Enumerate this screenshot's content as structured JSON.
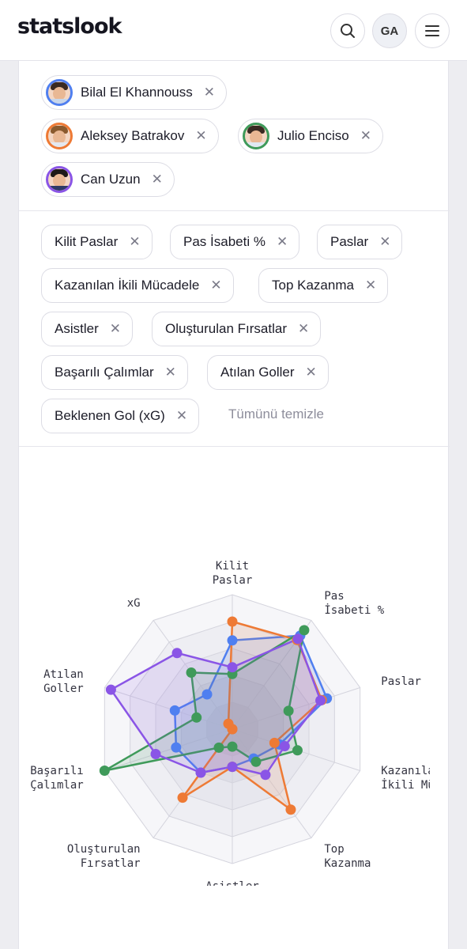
{
  "header": {
    "logo": "statslook",
    "avatar_initials": "GA"
  },
  "players": [
    {
      "name": "Bilal El Khannouss",
      "color": "#4f7ff0"
    },
    {
      "name": "Aleksey Batrakov",
      "color": "#ee7a35"
    },
    {
      "name": "Julio Enciso",
      "color": "#3f9a5a"
    },
    {
      "name": "Can Uzun",
      "color": "#8a55e6"
    }
  ],
  "metrics": [
    "Kilit Paslar",
    "Pas İsabeti %",
    "Paslar",
    "Kazanılan İkili Mücadele",
    "Top Kazanma",
    "Asistler",
    "Oluşturulan Fırsatlar",
    "Başarılı Çalımlar",
    "Atılan Goller",
    "Beklenen Gol (xG)"
  ],
  "clear_all": "Tümünü temizle",
  "chart_data": {
    "type": "radar",
    "axes": [
      [
        "Kilit",
        "Paslar"
      ],
      [
        "Pas",
        "İsabeti %"
      ],
      [
        "Paslar"
      ],
      [
        "Kazanıla",
        "İkili Mü"
      ],
      [
        "Top",
        "Kazanma"
      ],
      [
        "Asistler"
      ],
      [
        "Oluşturulan",
        "Fırsatlar"
      ],
      [
        "Başarılı",
        "Çalımlar"
      ],
      [
        "Atılan",
        "Goller"
      ],
      [
        "xG"
      ]
    ],
    "grid_levels": 5,
    "max": 1.0,
    "series": [
      {
        "name": "Bilal El Khannouss",
        "color": "#4f7ff0",
        "values": [
          0.66,
          0.86,
          0.74,
          0.37,
          0.27,
          0.28,
          0.4,
          0.44,
          0.45,
          0.32
        ]
      },
      {
        "name": "Aleksey Batrakov",
        "color": "#ee7a35",
        "values": [
          0.8,
          0.82,
          0.7,
          0.33,
          0.74,
          0.28,
          0.63,
          0.0,
          0.0,
          0.05
        ]
      },
      {
        "name": "Julio Enciso",
        "color": "#3f9a5a",
        "values": [
          0.41,
          0.91,
          0.44,
          0.51,
          0.3,
          0.13,
          0.17,
          1.0,
          0.28,
          0.52
        ]
      },
      {
        "name": "Can Uzun",
        "color": "#8a55e6",
        "values": [
          0.46,
          0.83,
          0.69,
          0.41,
          0.42,
          0.28,
          0.4,
          0.6,
          0.95,
          0.7
        ]
      }
    ]
  }
}
